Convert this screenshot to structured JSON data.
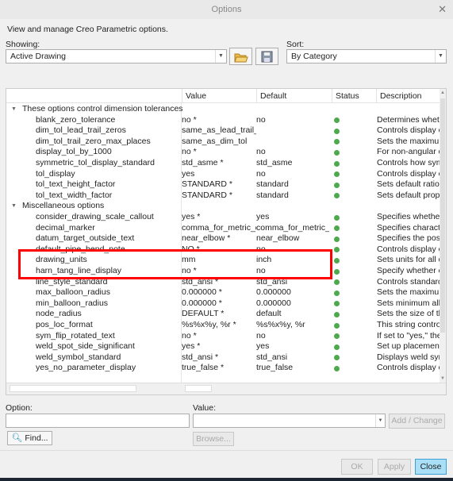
{
  "window": {
    "title": "Options"
  },
  "intro": "View and manage Creo Parametric options.",
  "showing": {
    "label": "Showing:",
    "value": "Active Drawing"
  },
  "sort": {
    "label": "Sort:",
    "value": "By Category"
  },
  "columns": [
    "",
    "Value",
    "Default",
    "Status",
    "Description"
  ],
  "groups": [
    {
      "title": "These options control dimension tolerances",
      "rows": [
        {
          "name": "blank_zero_tolerance",
          "value": "no *",
          "default": "no",
          "desc": "Determines wheth"
        },
        {
          "name": "dim_tol_lead_trail_zeros",
          "value": "same_as_lead_trail_zeros",
          "default": "",
          "desc": "Controls display o"
        },
        {
          "name": "dim_tol_trail_zero_max_places",
          "value": "same_as_dim_tol",
          "default": "",
          "desc": "Sets the maximum"
        },
        {
          "name": "display_tol_by_1000",
          "value": "no *",
          "default": "no",
          "desc": "For non-angular d"
        },
        {
          "name": "symmetric_tol_display_standard",
          "value": "std_asme *",
          "default": "std_asme",
          "desc": "Controls how sym"
        },
        {
          "name": "tol_display",
          "value": "yes",
          "default": "no",
          "desc": "Controls display o"
        },
        {
          "name": "tol_text_height_factor",
          "value": "STANDARD *",
          "default": "standard",
          "desc": "Sets default ratio b"
        },
        {
          "name": "tol_text_width_factor",
          "value": "STANDARD *",
          "default": "standard",
          "desc": "Sets default propo"
        }
      ]
    },
    {
      "title": "Miscellaneous options",
      "rows": [
        {
          "name": "consider_drawing_scale_callout",
          "value": "yes *",
          "default": "yes",
          "desc": "Specifies whether"
        },
        {
          "name": "decimal_marker",
          "value": "comma_for_metric_dual",
          "default": "comma_for_metric_dual",
          "desc": "Specifies characte"
        },
        {
          "name": "datum_target_outside_text",
          "value": "near_elbow *",
          "default": "near_elbow",
          "desc": "Specifies the posit"
        },
        {
          "name": "default_pipe_bend_note",
          "value": "NO *",
          "default": "no",
          "desc": "Controls display o"
        },
        {
          "name": "drawing_units",
          "value": "mm",
          "default": "inch",
          "desc": "Sets units for all dr"
        },
        {
          "name": "harn_tang_line_display",
          "value": "no *",
          "default": "no",
          "desc": "Specify whether o"
        },
        {
          "name": "line_style_standard",
          "value": "std_ansi *",
          "default": "std_ansi",
          "desc": "Controls standard"
        },
        {
          "name": "max_balloon_radius",
          "value": "0.000000 *",
          "default": "0.000000",
          "desc": "Sets the maximum"
        },
        {
          "name": "min_balloon_radius",
          "value": "0.000000 *",
          "default": "0.000000",
          "desc": "Sets minimum allo"
        },
        {
          "name": "node_radius",
          "value": "DEFAULT *",
          "default": "default",
          "desc": "Sets the size of the"
        },
        {
          "name": "pos_loc_format",
          "value": "%s%x%y, %r *",
          "default": "%s%x%y, %r",
          "desc": "This string control"
        },
        {
          "name": "sym_flip_rotated_text",
          "value": "no *",
          "default": "no",
          "desc": "If set to \"yes,\" ther"
        },
        {
          "name": "weld_spot_side_significant",
          "value": "yes *",
          "default": "yes",
          "desc": "Set up placement"
        },
        {
          "name": "weld_symbol_standard",
          "value": "std_ansi *",
          "default": "std_ansi",
          "desc": "Displays weld sym"
        },
        {
          "name": "yes_no_parameter_display",
          "value": "true_false *",
          "default": "true_false",
          "desc": "Controls display o"
        }
      ]
    }
  ],
  "status_color": "#4caa4c",
  "highlight_color": "#ff0000",
  "option": {
    "label": "Option:",
    "value": ""
  },
  "value": {
    "label": "Value:",
    "value": ""
  },
  "buttons": {
    "add_change": "Add / Change",
    "find": "Find...",
    "browse": "Browse...",
    "ok": "OK",
    "apply": "Apply",
    "close": "Close"
  }
}
